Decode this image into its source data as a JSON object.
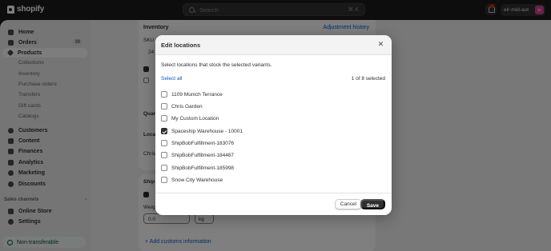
{
  "topbar": {
    "brand": "shopify",
    "search_placeholder": "Search",
    "search_shortcut": "⌘ K",
    "store_name": "eir-mid-aut",
    "store_initials": "ei"
  },
  "sidebar": {
    "items": [
      {
        "label": "Home",
        "icon": "home-icon"
      },
      {
        "label": "Orders",
        "icon": "orders-icon",
        "count": "39"
      },
      {
        "label": "Products",
        "icon": "tag-icon",
        "active": true
      }
    ],
    "product_sub": [
      "Collections",
      "Inventory",
      "Purchase orders",
      "Transfers",
      "Gift cards",
      "Catalogs"
    ],
    "items2": [
      {
        "label": "Customers",
        "icon": "person-icon"
      },
      {
        "label": "Content",
        "icon": "content-icon"
      },
      {
        "label": "Finances",
        "icon": "bank-icon"
      },
      {
        "label": "Analytics",
        "icon": "chart-icon"
      },
      {
        "label": "Marketing",
        "icon": "target-icon"
      },
      {
        "label": "Discounts",
        "icon": "discount-icon"
      }
    ],
    "sales_channels_label": "Sales channels",
    "sales_channels": [
      {
        "label": "Online Store",
        "icon": "store-icon"
      },
      {
        "label": "Settings",
        "icon": "gear-icon"
      }
    ],
    "footer_badge": "Non-transferable"
  },
  "background": {
    "inventory_title": "Inventory",
    "inventory_link": "Adjustment history",
    "sku_label": "SKU",
    "sku_value": "24",
    "quantity_label": "Quar",
    "location_label": "Loca",
    "location_value": "Chris",
    "shipping_label": "Ship",
    "weight_label": "Weig",
    "weight_value": "0.0",
    "weight_unit": "kg",
    "customs_link": "+ Add customs information"
  },
  "modal": {
    "title": "Edit locations",
    "description": "Select locations that stock the selected variants.",
    "select_all": "Select all",
    "selected_count": "1 of 8 selected",
    "locations": [
      {
        "label": "1109 Munich Terrance",
        "checked": false
      },
      {
        "label": "Chris Garden",
        "checked": false
      },
      {
        "label": "My Custom Location",
        "checked": false
      },
      {
        "label": "Spaceship Warehouse - 10001",
        "checked": true
      },
      {
        "label": "ShipBobFulfillment-183076",
        "checked": false
      },
      {
        "label": "ShipBobFulfillment-184467",
        "checked": false
      },
      {
        "label": "ShipBobFulfillment-185998",
        "checked": false
      },
      {
        "label": "Snow City Warehouse",
        "checked": false
      }
    ],
    "cancel_label": "Cancel",
    "save_label": "Save"
  }
}
